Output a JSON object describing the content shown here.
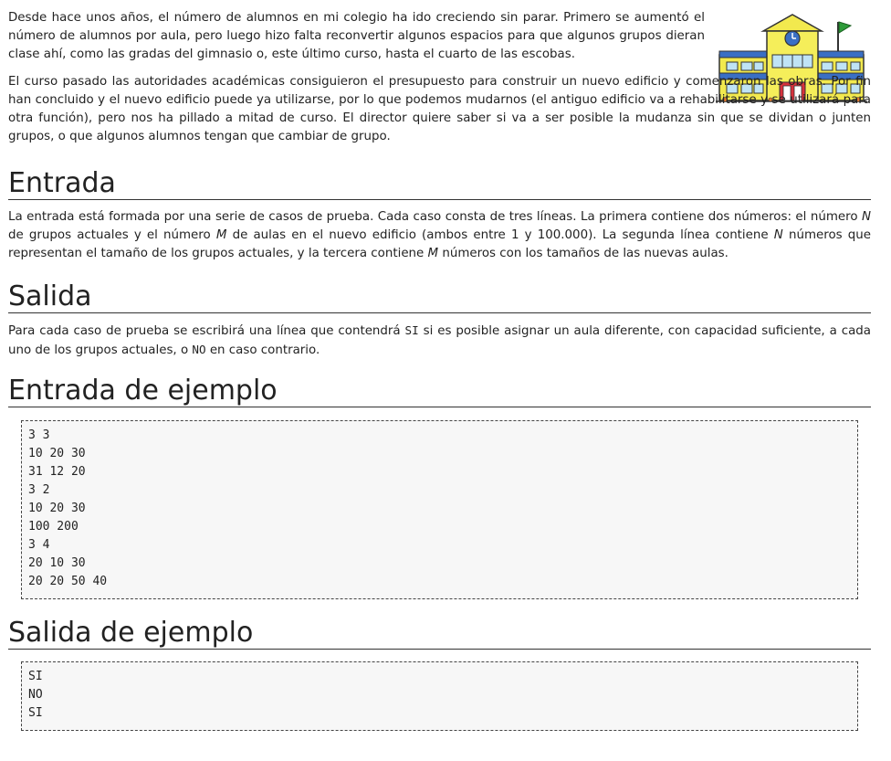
{
  "intro": {
    "p1": "Desde hace unos años, el número de alumnos en mi colegio ha ido creciendo sin parar. Primero se aumentó el número de alumnos por aula, pero luego hizo falta reconvertir algunos espacios para que algunos grupos dieran clase ahí, como las gradas del gimnasio o, este último curso, hasta el cuarto de las escobas.",
    "p2": "El curso pasado las autoridades académicas consiguieron el presupuesto para construir un nuevo edificio y comenzaron las obras. Por fin han concluido y el nuevo edificio puede ya utilizarse, por lo que podemos mudarnos (el antiguo edificio va a rehabilitarse y se utilizará para otra función), pero nos ha pillado a mitad de curso. El director quiere saber si va a ser posible la mudanza sin que se dividan o junten grupos, o que algunos alumnos tengan que cambiar de grupo."
  },
  "entrada": {
    "heading": "Entrada",
    "text_a": "La entrada está formada por una serie de casos de prueba. Cada caso consta de tres líneas. La primera contiene dos números: el número ",
    "var_n": "N",
    "text_b": " de grupos actuales y el número ",
    "var_m": "M",
    "text_c": " de aulas en el nuevo edificio (ambos entre 1 y 100.000). La segunda línea contiene ",
    "var_n2": "N",
    "text_d": " números que representan el tamaño de los grupos actuales, y la tercera contiene ",
    "var_m2": "M",
    "text_e": " números con los tamaños de las nuevas aulas."
  },
  "salida": {
    "heading": "Salida",
    "text_a": "Para cada caso de prueba se escribirá una línea que contendrá ",
    "code_si": "SI",
    "text_b": " si es posible asignar un aula diferente, con capacidad suficiente, a cada uno de los grupos actuales, o ",
    "code_no": "NO",
    "text_c": " en caso contrario."
  },
  "entrada_ejemplo": {
    "heading": "Entrada de ejemplo",
    "content": "3 3\n10 20 30\n31 12 20\n3 2\n10 20 30\n100 200\n3 4\n20 10 30\n20 20 50 40"
  },
  "salida_ejemplo": {
    "heading": "Salida de ejemplo",
    "content": "SI\nNO\nSI"
  },
  "illustration": {
    "icon": "school-building-icon"
  }
}
